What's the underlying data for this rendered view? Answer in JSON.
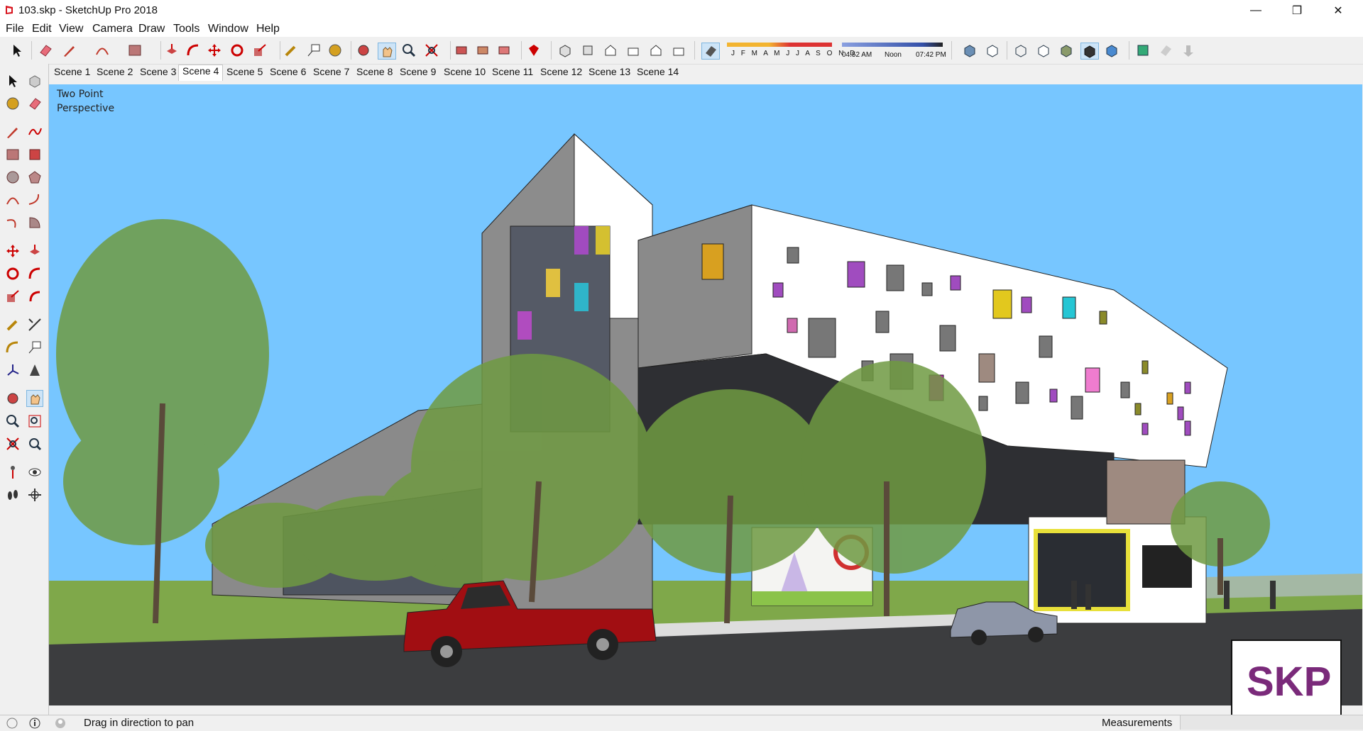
{
  "window": {
    "title": "103.skp - SketchUp Pro 2018",
    "min": "—",
    "max": "❐",
    "close": "✕"
  },
  "menu": [
    "File",
    "Edit",
    "View",
    "Camera",
    "Draw",
    "Tools",
    "Window",
    "Help"
  ],
  "shadow_panel": {
    "months": "J F M A M J J A S O N D",
    "time_start": "04:52 AM",
    "time_noon": "Noon",
    "time_end": "07:42 PM"
  },
  "scenes": {
    "tabs": [
      "Scene 1",
      "Scene 2",
      "Scene 3",
      "Scene 4",
      "Scene 5",
      "Scene 6",
      "Scene 7",
      "Scene 8",
      "Scene 9",
      "Scene 10",
      "Scene 11",
      "Scene 12",
      "Scene 13",
      "Scene 14"
    ],
    "active": "Scene 4"
  },
  "viewport": {
    "camera_line1": "Two Point",
    "camera_line2": "Perspective",
    "sky_color": "#77c6ff",
    "ground_color": "#7fa84a",
    "road_color": "#3c3d3f",
    "wall_color": "#ffffff",
    "dark_wall_color": "#8a8a8a",
    "truck_color": "#a10e12",
    "car_color": "#8e96a8"
  },
  "status": {
    "hint": "Drag in direction to pan",
    "measurements_label": "Measurements",
    "measurements_value": ""
  },
  "watermark": {
    "text": "SKP",
    "color": "#7a2a7a"
  },
  "icons": {
    "toolbar": [
      "select-icon",
      "eraser-icon",
      "pencil-icon",
      "arc-icon",
      "rectangle-icon",
      "pushpull-icon",
      "followme-icon",
      "move-icon",
      "rotate-icon",
      "scale-icon",
      "tape-icon",
      "text-icon",
      "paint-icon",
      "orbit-icon",
      "pan-icon",
      "zoom-icon",
      "zoom-extents-icon",
      "components-icon",
      "warehouse-icon",
      "extension-icon",
      "ruby-icon",
      "iso-view-icon",
      "top-view-icon",
      "front-view-icon",
      "right-view-icon",
      "back-view-icon",
      "left-view-icon",
      "shadow-toggle-icon",
      "xray-icon",
      "back-edges-icon",
      "wireframe-icon",
      "hidden-line-icon",
      "shaded-icon",
      "shaded-textures-icon",
      "monochrome-icon",
      "section-plane-icon",
      "section-cut-icon",
      "section-fill-icon"
    ]
  }
}
